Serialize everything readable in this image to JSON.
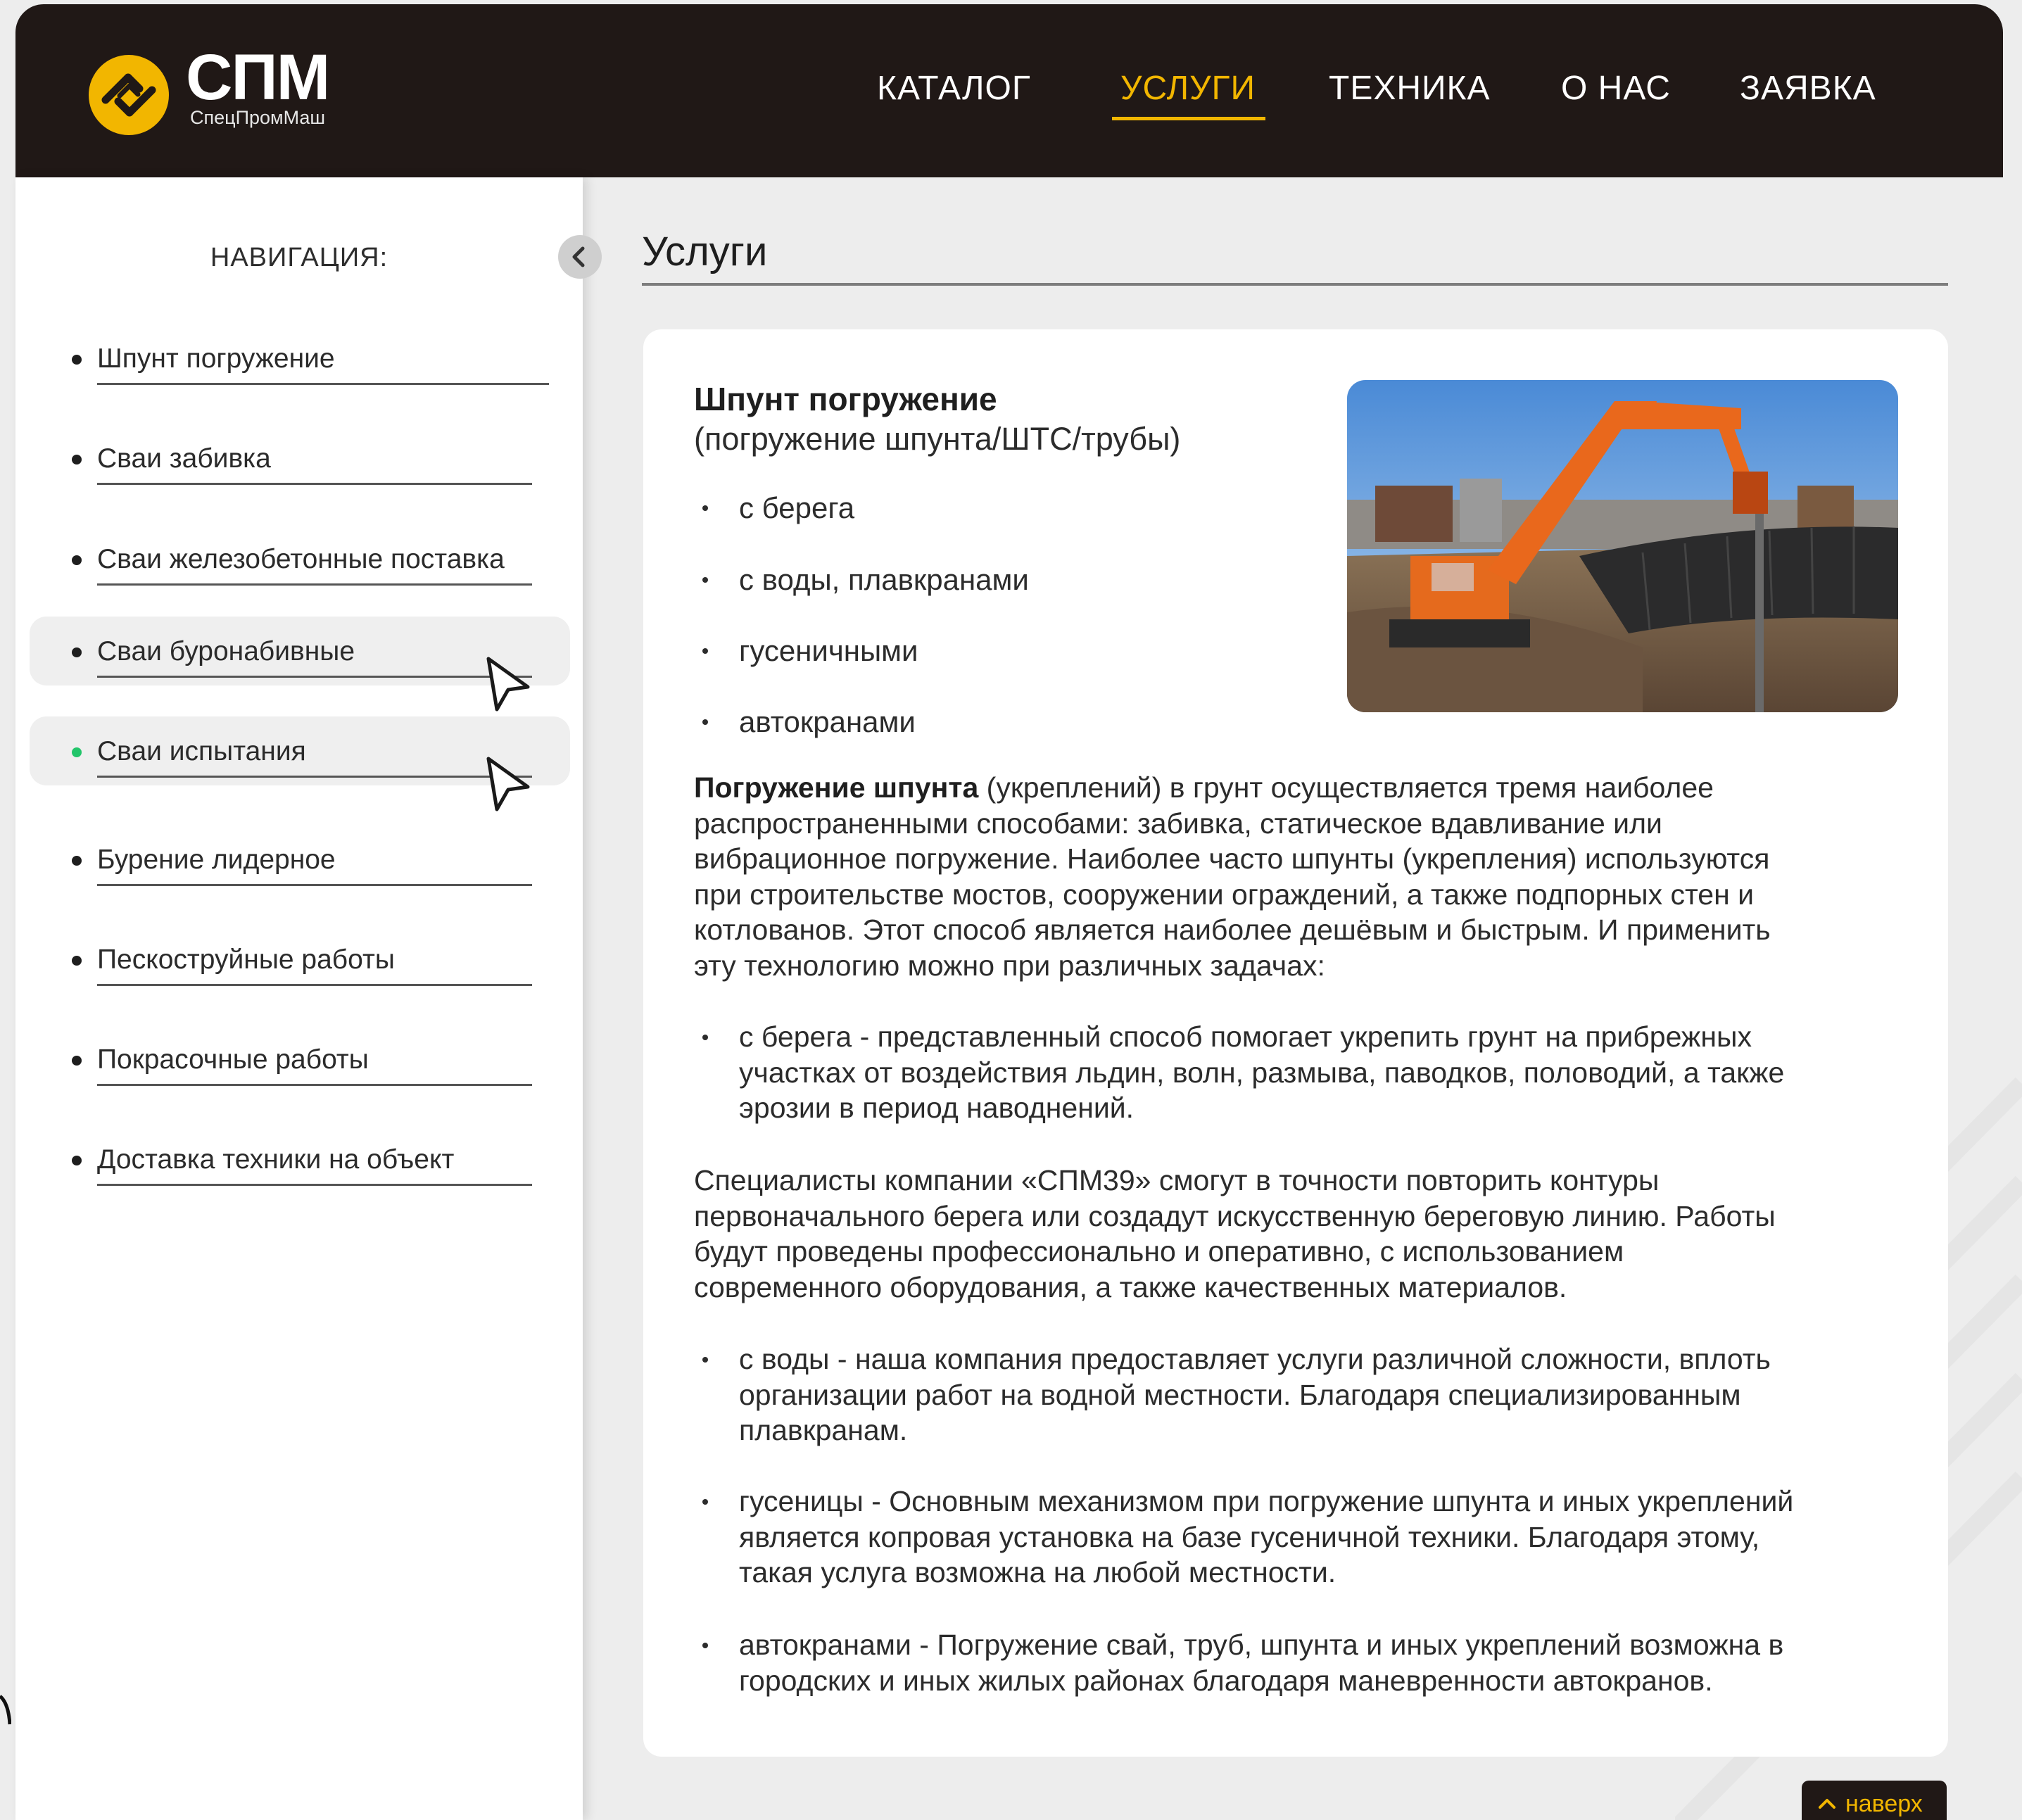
{
  "brand": {
    "title": "СПМ",
    "subtitle": "СпецПромМаш",
    "accent": "#f2b600"
  },
  "nav": {
    "items": [
      "КАТАЛОГ",
      "УСЛУГИ",
      "ТЕХНИКА",
      "О НАС",
      "ЗАЯВКА"
    ],
    "active": "УСЛУГИ"
  },
  "sidebar": {
    "title": "НАВИГАЦИЯ:",
    "items": [
      {
        "label": "Шпунт погружение"
      },
      {
        "label": "Сваи забивка"
      },
      {
        "label": "Сваи железобетонные поставка"
      },
      {
        "label": "Сваи буронабивные"
      },
      {
        "label": "Сваи испытания"
      },
      {
        "label": "Бурение лидерное"
      },
      {
        "label": "Пескоструйные работы"
      },
      {
        "label": "Покрасочные работы"
      },
      {
        "label": "Доставка техники на объект"
      }
    ]
  },
  "main": {
    "title": "Услуги",
    "service": {
      "title": "Шпунт погружение",
      "subtitle": "(погружение шпунта/ШТС/трубы)",
      "methods": [
        "с берега",
        "с воды, плавкранами",
        "гусеничными",
        "автокранами"
      ],
      "intro_bold": "Погружение шпунта",
      "intro_line1": " (укреплений) в грунт осуществляется тремя наиболее",
      "intro_lines": [
        "распространенными способами: забивка, статическое вдавливание или",
        "вибрационное погружение. Наиболее часто шпунты (укрепления) используются",
        "при строительстве мостов, сооружении ограждений, а также подпорных стен и",
        "котлованов. Этот способ является наиболее дешёвым и быстрым. И применить",
        "эту технологию можно при различных задачах:"
      ],
      "detail1": [
        "с берега - представленный способ помогает укрепить грунт на прибрежных",
        "участках от воздействия льдин, волн, размыва, паводков, половодий, а также",
        "эрозии в период наводнений."
      ],
      "specialists": [
        "Специалисты компании «СПМ39» смогут в точности повторить контуры",
        "первоначального берега или создадут искусственную береговую линию. Работы",
        "будут проведены профессионально и оперативно, с использованием",
        "современного оборудования, а также качественных материалов."
      ],
      "detail2": [
        "с воды - наша компания предоставляет услуги различной сложности, вплоть",
        "организации работ на водной местности. Благодаря специализированным",
        "плавкранам."
      ],
      "detail3": [
        "гусеницы - Основным механизмом при погружение шпунта и иных укреплений",
        "является копровая установка на базе гусеничной техники. Благодаря этому,",
        "такая услуга возможна на любой местности."
      ],
      "detail4": [
        "автокранами - Погружение свай, труб, шпунта и иных укреплений возможна в",
        "городских и иных жилых районах благодаря маневренности автокранов."
      ]
    }
  },
  "back_to_top": "наверх",
  "colors": {
    "header_bg": "#201816",
    "active_dot": "#22c56a"
  }
}
